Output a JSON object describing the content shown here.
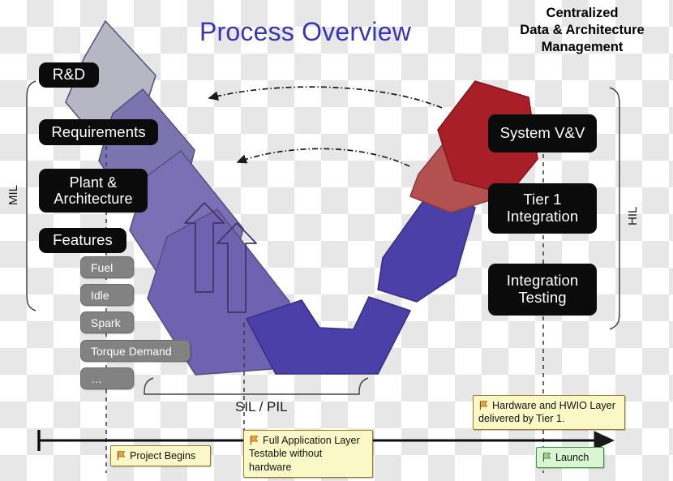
{
  "title": "Process Overview",
  "header": {
    "line1": "Centralized",
    "line2": "Data & Architecture",
    "line3": "Management"
  },
  "brackets": {
    "mil": "MIL",
    "hil": "HIL",
    "sil_pil": "SIL / PIL"
  },
  "left_phases": [
    {
      "label": "R&D"
    },
    {
      "label": "Requirements"
    },
    {
      "label": "Plant &\nArchitecture",
      "line1": "Plant &",
      "line2": "Architecture"
    },
    {
      "label": "Features"
    }
  ],
  "features": [
    {
      "label": "Fuel"
    },
    {
      "label": "Idle"
    },
    {
      "label": "Spark"
    },
    {
      "label": "Torque Demand"
    },
    {
      "label": "…"
    }
  ],
  "right_phases": [
    {
      "label": "System V&V",
      "line1": "System V&V",
      "line2": ""
    },
    {
      "label": "Tier 1 Integration",
      "line1": "Tier 1",
      "line2": "Integration"
    },
    {
      "label": "Integration Testing",
      "line1": "Integration",
      "line2": "Testing"
    }
  ],
  "callouts": [
    {
      "id": "project-begins",
      "text": "Project Begins",
      "style": "yellow"
    },
    {
      "id": "full-application-layer",
      "text": "Full Application Layer Testable without hardware",
      "style": "yellow"
    },
    {
      "id": "hardware-hwio",
      "text": "Hardware and HWIO Layer delivered by Tier 1.",
      "style": "yellow"
    },
    {
      "id": "launch",
      "text": "Launch",
      "style": "green"
    }
  ],
  "colors": {
    "title": "#3a36b0",
    "chip_bg": "#0b0b0b",
    "pill_bg": "#828282",
    "seg_rd": "#b7b7c4",
    "seg_requirements": "#7c74ae",
    "seg_plant": "#7b6fb5",
    "seg_features": "#6f62b0",
    "seg_v_bottom": "#4b3fa8",
    "seg_integration_testing": "#4b3fa8",
    "seg_tier1": "#b35050",
    "seg_system_vv": "#a81f28",
    "callout_yellow": "#fbf8c8",
    "callout_green": "#d9f5d1",
    "flag": "#e8a33d"
  },
  "icons": {
    "flag": "flag-icon",
    "timeline_arrow": "arrow-right-icon",
    "feedback_arrow": "curved-arrow-left-icon"
  }
}
